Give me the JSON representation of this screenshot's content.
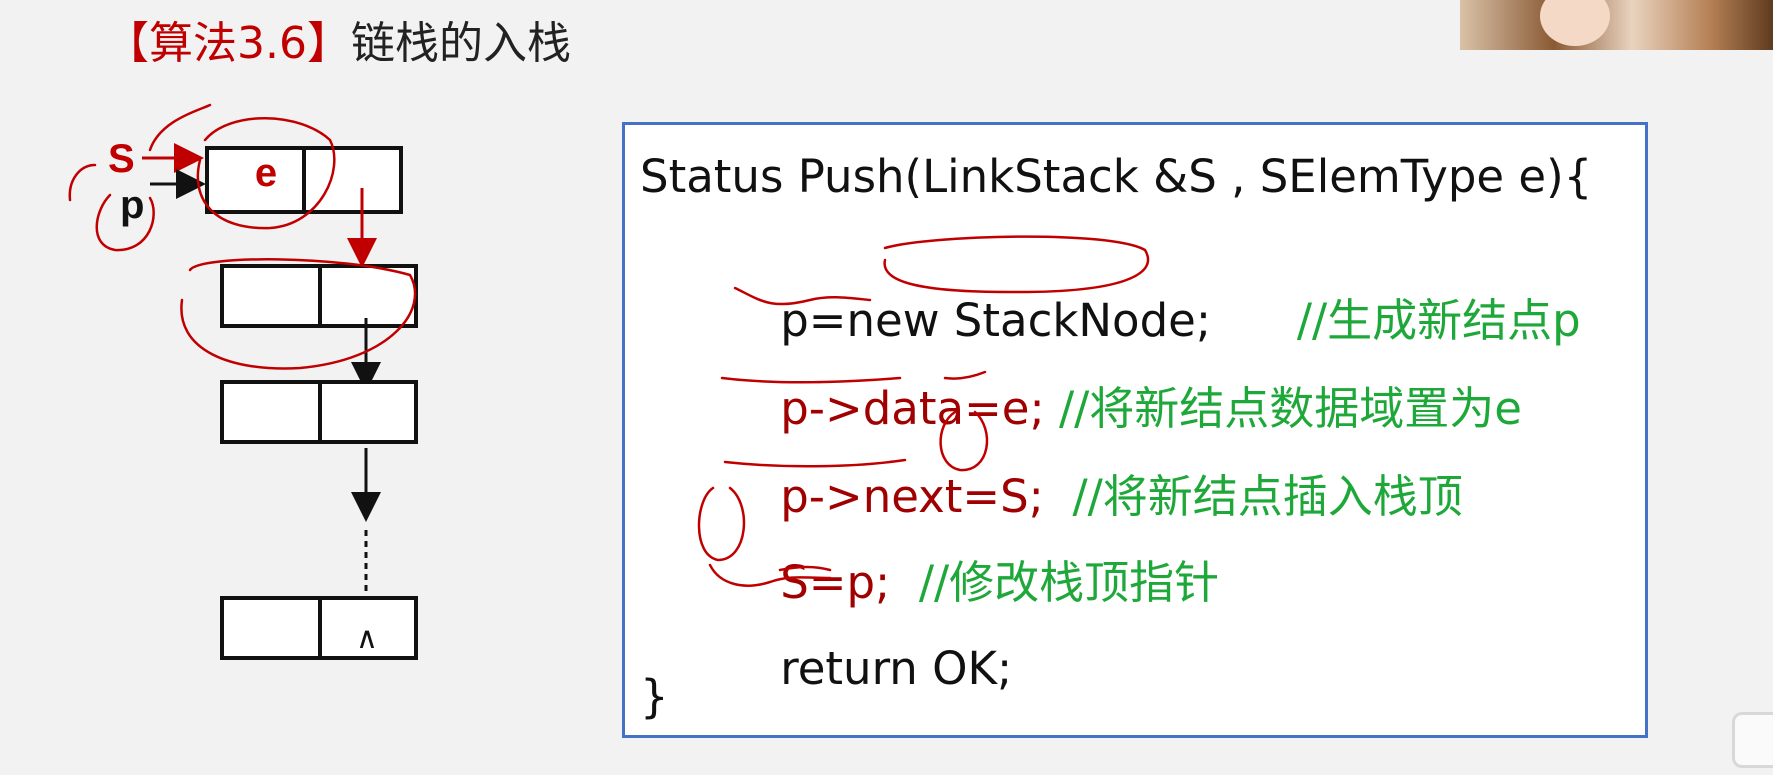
{
  "title": {
    "tag": "【算法3.6】",
    "text": "链栈的入栈"
  },
  "diagram": {
    "top_pointer_label": "S",
    "new_pointer_label": "p",
    "new_node_data": "e",
    "bottom_null_symbol": "∧"
  },
  "code": {
    "line1": "Status Push(LinkStack &S , SElemType e){",
    "line2_stmt": "p=new StackNode;",
    "line2_comment": "//生成新结点p",
    "line3_stmt": "p->data=e;",
    "line3_comment": "//将新结点数据域置为e",
    "line4_stmt": "p->next=S;",
    "line4_comment": "//将新结点插入栈顶",
    "line5_stmt": "S=p;",
    "line5_comment": "//修改栈顶指针",
    "line6_stmt": "return OK;",
    "line7": "}"
  },
  "colors": {
    "title_tag": "#c00000",
    "panel_border": "#4472c4",
    "comment": "#1fa83a",
    "annotation_ink": "#c00000"
  },
  "icons": [
    "webcam-thumbnail",
    "bilibili-tv-icon"
  ]
}
